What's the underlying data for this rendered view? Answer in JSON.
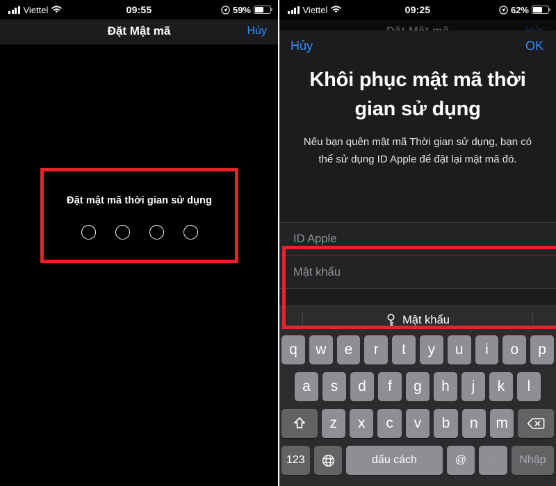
{
  "left": {
    "status": {
      "carrier": "Viettel",
      "time": "09:55",
      "battery_percent": "59%",
      "signal_icon": "cellular-bars-icon",
      "wifi_icon": "wifi-icon",
      "location_icon": "location-arrow-icon",
      "battery_icon": "battery-icon"
    },
    "nav": {
      "title": "Đặt Mật mã",
      "cancel": "Hủy"
    },
    "passcode": {
      "label": "Đặt mật mã thời gian sử dụng",
      "digits": 4,
      "entered": 0,
      "highlight_color": "#e8222c"
    }
  },
  "right": {
    "status": {
      "carrier": "Viettel",
      "time": "09:25",
      "battery_percent": "62%",
      "signal_icon": "cellular-bars-icon",
      "wifi_icon": "wifi-icon",
      "location_icon": "location-arrow-icon",
      "battery_icon": "battery-icon"
    },
    "behind_nav": {
      "title": "Đặt Mật mã",
      "cancel": "Hủy"
    },
    "sheet": {
      "cancel": "Hủy",
      "ok": "OK",
      "title": "Khôi phục mật mã thời gian sử dụng",
      "subtitle": "Nếu bạn quên mật mã Thời gian sử dụng, bạn có thể sử dụng ID Apple để đặt lại mật mã đó.",
      "fields": [
        {
          "name": "apple-id",
          "placeholder": "ID Apple",
          "value": ""
        },
        {
          "name": "password",
          "placeholder": "Mật khẩu",
          "value": ""
        }
      ],
      "highlight_color": "#e8222c"
    },
    "keyboard": {
      "autofill_label": "Mật khẩu",
      "autofill_icon": "key-icon",
      "row1": [
        "q",
        "w",
        "e",
        "r",
        "t",
        "y",
        "u",
        "i",
        "o",
        "p"
      ],
      "row2": [
        "a",
        "s",
        "d",
        "f",
        "g",
        "h",
        "j",
        "k",
        "l"
      ],
      "row3": [
        "z",
        "x",
        "c",
        "v",
        "b",
        "n",
        "m"
      ],
      "shift_icon": "shift-up-arrow-icon",
      "backspace_icon": "delete-backward-icon",
      "numbers_key": "123",
      "globe_icon": "globe-icon",
      "space_key": "dấu cách",
      "at_key": "@",
      "period_key": ".",
      "return_key": "Nhập"
    }
  }
}
